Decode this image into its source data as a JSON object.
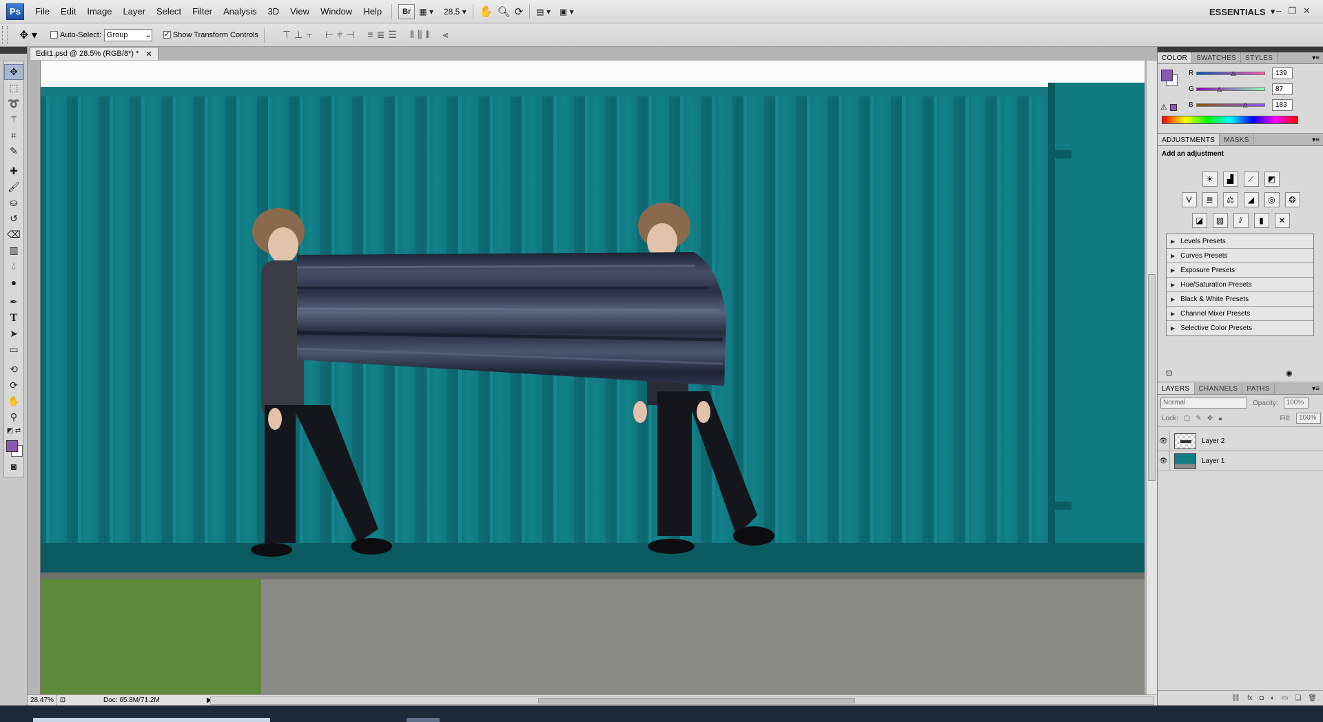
{
  "app": {
    "logo": "Ps",
    "menus": [
      "File",
      "Edit",
      "Image",
      "Layer",
      "Select",
      "Filter",
      "Analysis",
      "3D",
      "View",
      "Window",
      "Help"
    ],
    "bridge_label": "Br",
    "zoom_menu_value": "28.5",
    "workspace": "ESSENTIALS",
    "window_controls": [
      "–",
      "❐",
      "✕"
    ]
  },
  "options": {
    "auto_select_label": "Auto-Select:",
    "auto_select_checked": false,
    "auto_select_value": "Group",
    "show_transform_label": "Show Transform Controls",
    "show_transform_checked": true
  },
  "document": {
    "tab_title": "Edit1.psd @ 28.5% (RGB/8*) *",
    "tab_close": "✕",
    "zoom_status": "28.47%",
    "doc_info": "Doc: 65.8M/71.2M"
  },
  "colors": {
    "foreground": "#8b57b7",
    "container_teal": "#137f86",
    "container_dark": "#0d5e64"
  },
  "color_panel": {
    "tabs": [
      "COLOR",
      "SWATCHES",
      "STYLES"
    ],
    "channels": [
      {
        "label": "R",
        "value": "139",
        "fraction": 0.545
      },
      {
        "label": "G",
        "value": "87",
        "fraction": 0.341
      },
      {
        "label": "B",
        "value": "183",
        "fraction": 0.718
      }
    ]
  },
  "adjustments_panel": {
    "tabs": [
      "ADJUSTMENTS",
      "MASKS"
    ],
    "title": "Add an adjustment",
    "presets": [
      "Levels Presets",
      "Curves Presets",
      "Exposure Presets",
      "Hue/Saturation Presets",
      "Black & White Presets",
      "Channel Mixer Presets",
      "Selective Color Presets"
    ]
  },
  "layers_panel": {
    "tabs": [
      "LAYERS",
      "CHANNELS",
      "PATHS"
    ],
    "blend_mode": "Normal",
    "opacity_label": "Opacity:",
    "opacity_value": "100%",
    "lock_label": "Lock:",
    "fill_label": "Fill:",
    "fill_value": "100%",
    "layers": [
      {
        "name": "Layer 2",
        "visible": true
      },
      {
        "name": "Layer 1",
        "visible": true
      }
    ]
  }
}
